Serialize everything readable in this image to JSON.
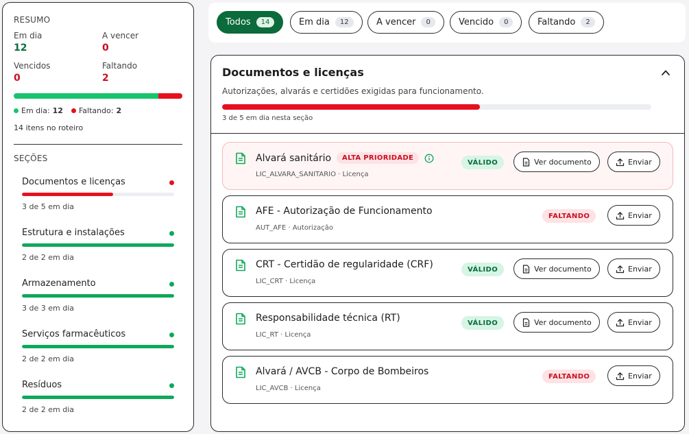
{
  "summary": {
    "title": "RESUMO",
    "em_dia_label": "Em dia",
    "em_dia_value": "12",
    "a_vencer_label": "A vencer",
    "a_vencer_value": "0",
    "vencidos_label": "Vencidos",
    "vencidos_value": "0",
    "faltando_label": "Faltando",
    "faltando_value": "2",
    "progress_ok_fraction": 0.857,
    "legend_ok_label": "Em dia:",
    "legend_ok_value": "12",
    "legend_miss_label": "Faltando:",
    "legend_miss_value": "2",
    "items_count": "14",
    "items_label": "itens no roteiro"
  },
  "sections_title": "SEÇÕES",
  "sections": [
    {
      "name": "Documentos e licenças",
      "note": "3 de 5 em dia",
      "fraction": 0.6,
      "status_color": "#e6101f"
    },
    {
      "name": "Estrutura e instalações",
      "note": "2 de 2 em dia",
      "fraction": 1.0,
      "status_color": "#0ea85a"
    },
    {
      "name": "Armazenamento",
      "note": "3 de 3 em dia",
      "fraction": 1.0,
      "status_color": "#0ea85a"
    },
    {
      "name": "Serviços farmacêuticos",
      "note": "2 de 2 em dia",
      "fraction": 1.0,
      "status_color": "#0ea85a"
    },
    {
      "name": "Resíduos",
      "note": "2 de 2 em dia",
      "fraction": 1.0,
      "status_color": "#0ea85a"
    }
  ],
  "filters": [
    {
      "label": "Todos",
      "count": "14",
      "active": true
    },
    {
      "label": "Em dia",
      "count": "12",
      "active": false
    },
    {
      "label": "A vencer",
      "count": "0",
      "active": false
    },
    {
      "label": "Vencido",
      "count": "0",
      "active": false
    },
    {
      "label": "Faltando",
      "count": "2",
      "active": false
    }
  ],
  "main": {
    "title": "Documentos e licenças",
    "subtitle": "Autorizações, alvarás e certidões exigidas para funcionamento.",
    "progress_fraction": 0.6,
    "progress_note": "3 de 5 em dia nesta seção"
  },
  "documents": [
    {
      "title": "Alvará sanitário",
      "priority": "ALTA PRIORIDADE",
      "code": "LIC_ALVARA_SANITARIO · Licença",
      "status": "VÁLIDO",
      "view_label": "Ver documento",
      "send_label": "Enviar"
    },
    {
      "title": "AFE - Autorização de Funcionamento",
      "code": "AUT_AFE · Autorização",
      "status": "FALTANDO",
      "send_label": "Enviar"
    },
    {
      "title": "CRT - Certidão de regularidade (CRF)",
      "code": "LIC_CRT · Licença",
      "status": "VÁLIDO",
      "view_label": "Ver documento",
      "send_label": "Enviar"
    },
    {
      "title": "Responsabilidade técnica (RT)",
      "code": "LIC_RT · Licença",
      "status": "VÁLIDO",
      "view_label": "Ver documento",
      "send_label": "Enviar"
    },
    {
      "title": "Alvará / AVCB - Corpo de Bombeiros",
      "code": "LIC_AVCB · Licença",
      "status": "FALTANDO",
      "send_label": "Enviar"
    }
  ],
  "colors": {
    "brand_green": "#0b6b3a",
    "ok_green": "#19c36e",
    "alert_red": "#e6101f"
  }
}
